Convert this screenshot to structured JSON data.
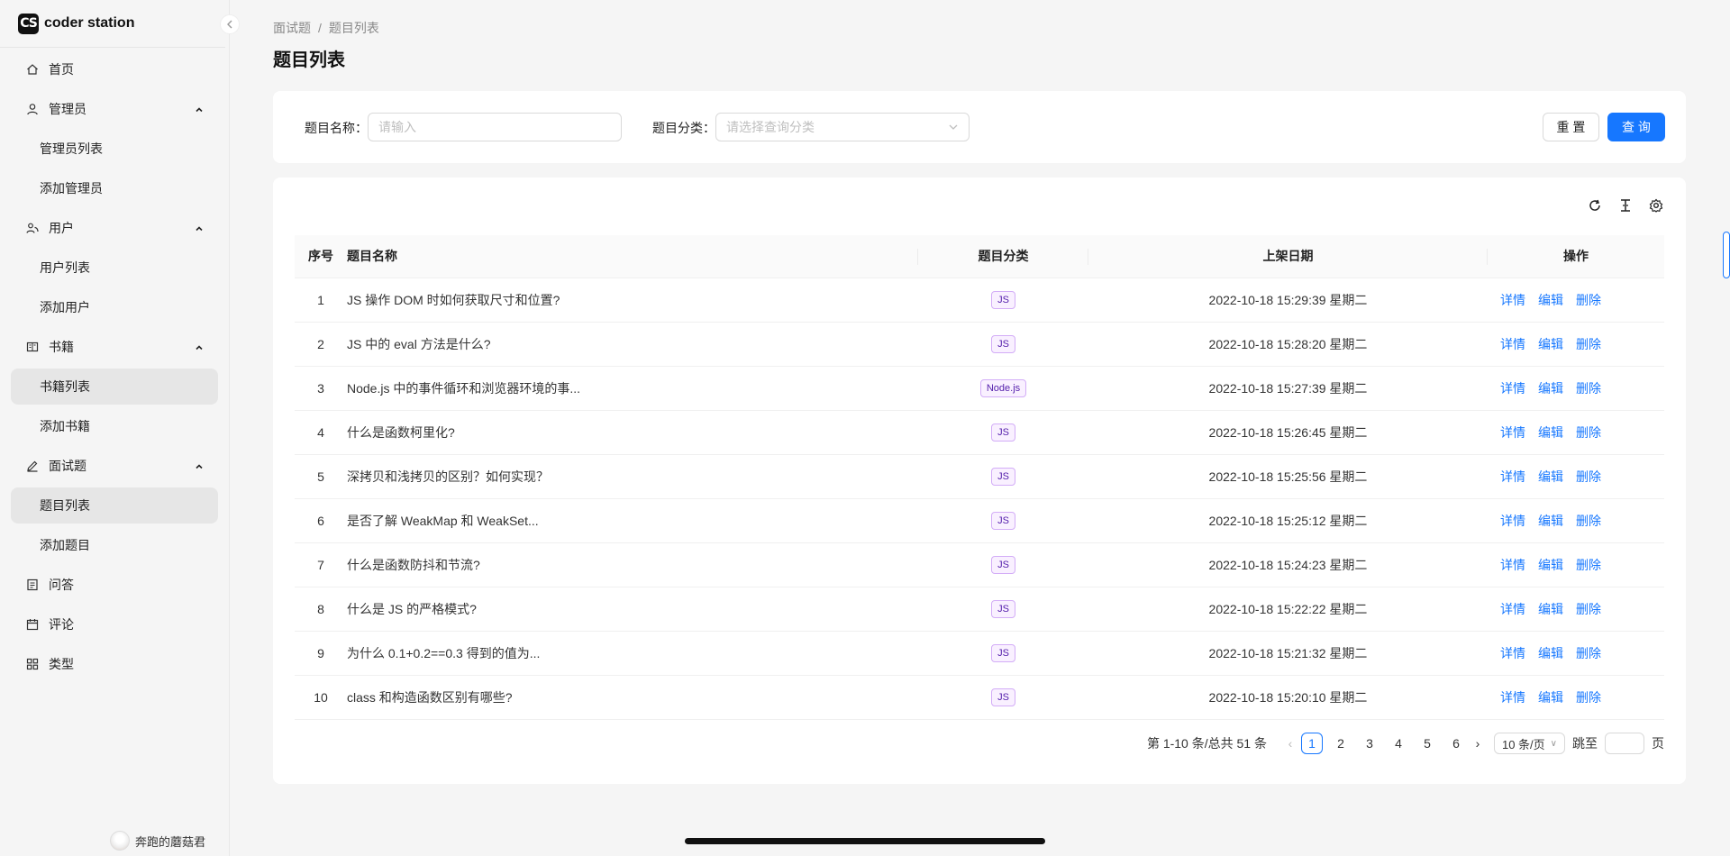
{
  "app": {
    "logo_mark": "CS",
    "name": "coder station"
  },
  "sidebar": {
    "items": [
      {
        "label": "首页",
        "icon": "home-icon"
      },
      {
        "label": "管理员",
        "icon": "user-icon",
        "expanded": true,
        "children": [
          {
            "label": "管理员列表"
          },
          {
            "label": "添加管理员"
          }
        ]
      },
      {
        "label": "用户",
        "icon": "team-icon",
        "expanded": true,
        "children": [
          {
            "label": "用户列表"
          },
          {
            "label": "添加用户"
          }
        ]
      },
      {
        "label": "书籍",
        "icon": "book-icon",
        "expanded": true,
        "children": [
          {
            "label": "书籍列表",
            "active": true
          },
          {
            "label": "添加书籍"
          }
        ]
      },
      {
        "label": "面试题",
        "icon": "edit-icon",
        "expanded": true,
        "children": [
          {
            "label": "题目列表",
            "active": true
          },
          {
            "label": "添加题目"
          }
        ]
      },
      {
        "label": "问答",
        "icon": "profile-icon"
      },
      {
        "label": "评论",
        "icon": "calendar-icon"
      },
      {
        "label": "类型",
        "icon": "appstore-icon"
      }
    ],
    "user_name": "奔跑的蘑菇君"
  },
  "breadcrumb": [
    "面试题",
    "题目列表"
  ],
  "page_title": "题目列表",
  "search": {
    "name_label": "题目名称",
    "name_placeholder": "请输入",
    "category_label": "题目分类",
    "category_placeholder": "请选择查询分类",
    "reset_label": "重 置",
    "query_label": "查 询"
  },
  "table": {
    "columns": [
      "序号",
      "题目名称",
      "题目分类",
      "上架日期",
      "操作"
    ],
    "rows": [
      {
        "no": "1",
        "name": "JS 操作 DOM 时如何获取尺寸和位置?",
        "category": "JS",
        "date": "2022-10-18 15:29:39 星期二"
      },
      {
        "no": "2",
        "name": "JS 中的 eval 方法是什么?",
        "category": "JS",
        "date": "2022-10-18 15:28:20 星期二"
      },
      {
        "no": "3",
        "name": "Node.js 中的事件循环和浏览器环境的事...",
        "category": "Node.js",
        "date": "2022-10-18 15:27:39 星期二"
      },
      {
        "no": "4",
        "name": "什么是函数柯里化?",
        "category": "JS",
        "date": "2022-10-18 15:26:45 星期二"
      },
      {
        "no": "5",
        "name": "深拷贝和浅拷贝的区别？如何实现？",
        "category": "JS",
        "date": "2022-10-18 15:25:56 星期二"
      },
      {
        "no": "6",
        "name": "是否了解 WeakMap 和 WeakSet...",
        "category": "JS",
        "date": "2022-10-18 15:25:12 星期二"
      },
      {
        "no": "7",
        "name": "什么是函数防抖和节流?",
        "category": "JS",
        "date": "2022-10-18 15:24:23 星期二"
      },
      {
        "no": "8",
        "name": "什么是 JS 的严格模式?",
        "category": "JS",
        "date": "2022-10-18 15:22:22 星期二"
      },
      {
        "no": "9",
        "name": "为什么 0.1+0.2==0.3 得到的值为...",
        "category": "JS",
        "date": "2022-10-18 15:21:32 星期二"
      },
      {
        "no": "10",
        "name": "class 和构造函数区别有哪些?",
        "category": "JS",
        "date": "2022-10-18 15:20:10 星期二"
      }
    ],
    "actions": {
      "detail": "详情",
      "edit": "编辑",
      "delete": "删除"
    }
  },
  "pagination": {
    "total_text": "第 1-10 条/总共 51 条",
    "pages": [
      "1",
      "2",
      "3",
      "4",
      "5",
      "6"
    ],
    "current": "1",
    "page_size": "10 条/页",
    "jump_label": "跳至",
    "page_suffix": "页"
  },
  "colors": {
    "primary": "#1677ff",
    "tag_border": "#d3adf7",
    "tag_text": "#531dab"
  }
}
